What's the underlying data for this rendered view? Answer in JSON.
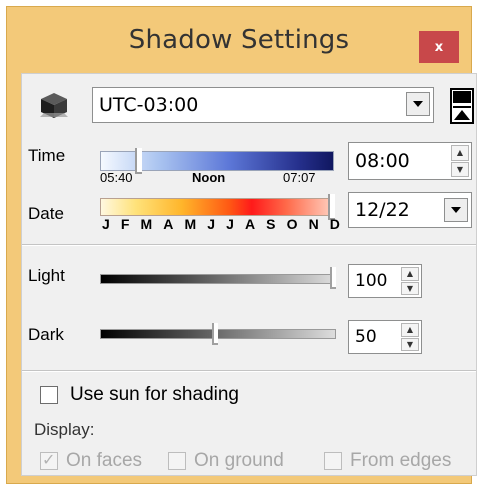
{
  "window": {
    "title": "Shadow Settings",
    "close_glyph": "x",
    "frame_color": "#f3c979",
    "close_color": "#c8484a"
  },
  "timezone": {
    "value": "UTC-03:00",
    "icon": "cube-icon",
    "expand_icon": "expand-toggle-icon"
  },
  "time": {
    "label": "Time",
    "sunrise": "05:40",
    "noon": "Noon",
    "sunset": "07:07",
    "value": "08:00",
    "slider_level": 0.15
  },
  "date": {
    "label": "Date",
    "months": [
      "J",
      "F",
      "M",
      "A",
      "M",
      "J",
      "J",
      "A",
      "S",
      "O",
      "N",
      "D"
    ],
    "value": "12/22",
    "slider_level": 0.98
  },
  "light": {
    "label": "Light",
    "value": "100",
    "slider_level": 1.0
  },
  "dark": {
    "label": "Dark",
    "value": "50",
    "slider_level": 0.5
  },
  "shading": {
    "use_sun_label": "Use sun for shading",
    "use_sun_checked": false
  },
  "display": {
    "label": "Display:",
    "on_faces_label": "On faces",
    "on_faces_checked": true,
    "on_ground_label": "On ground",
    "on_ground_checked": false,
    "from_edges_label": "From edges",
    "from_edges_checked": false
  }
}
